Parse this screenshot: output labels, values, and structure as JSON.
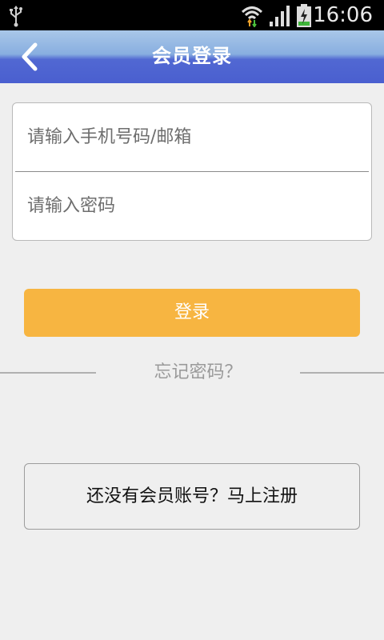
{
  "status_bar": {
    "time": "16:06",
    "icons": [
      "usb-icon",
      "wifi-icon",
      "signal-icon",
      "battery-charging-icon"
    ]
  },
  "header": {
    "title": "会员登录",
    "back_icon": "chevron-left-icon"
  },
  "form": {
    "account_placeholder": "请输入手机号码/邮箱",
    "password_placeholder": "请输入密码"
  },
  "actions": {
    "login_label": "登录",
    "forgot_label": "忘记密码？",
    "register_label": "还没有会员账号？马上注册"
  },
  "colors": {
    "accent": "#f7b541",
    "header_top": "#a9c7e8",
    "header_bottom": "#4a5fd0",
    "background": "#efefef"
  }
}
